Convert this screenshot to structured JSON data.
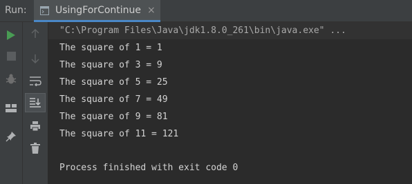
{
  "toolbar": {
    "run_label": "Run:",
    "tab_title": "UsingForContinue",
    "tab_close": "×",
    "tab_icon": "console-window-icon"
  },
  "gutter": {
    "left_icons": [
      "run-icon",
      "stop-icon",
      "debug-icon",
      "layout-icon",
      "pin-icon"
    ],
    "right_icons": [
      "up-arrow-icon",
      "down-arrow-icon",
      "soft-wrap-icon",
      "scroll-to-end-icon",
      "print-icon",
      "trash-icon"
    ]
  },
  "console": {
    "command": "\"C:\\Program Files\\Java\\jdk1.8.0_261\\bin\\java.exe\" ...",
    "lines": [
      "The square of 1 = 1",
      "The square of 3 = 9",
      "The square of 5 = 25",
      "The square of 7 = 49",
      "The square of 9 = 81",
      "The square of 11 = 121",
      "",
      "Process finished with exit code 0"
    ]
  },
  "colors": {
    "run_green": "#499c54",
    "accent_blue": "#4a88c7"
  }
}
